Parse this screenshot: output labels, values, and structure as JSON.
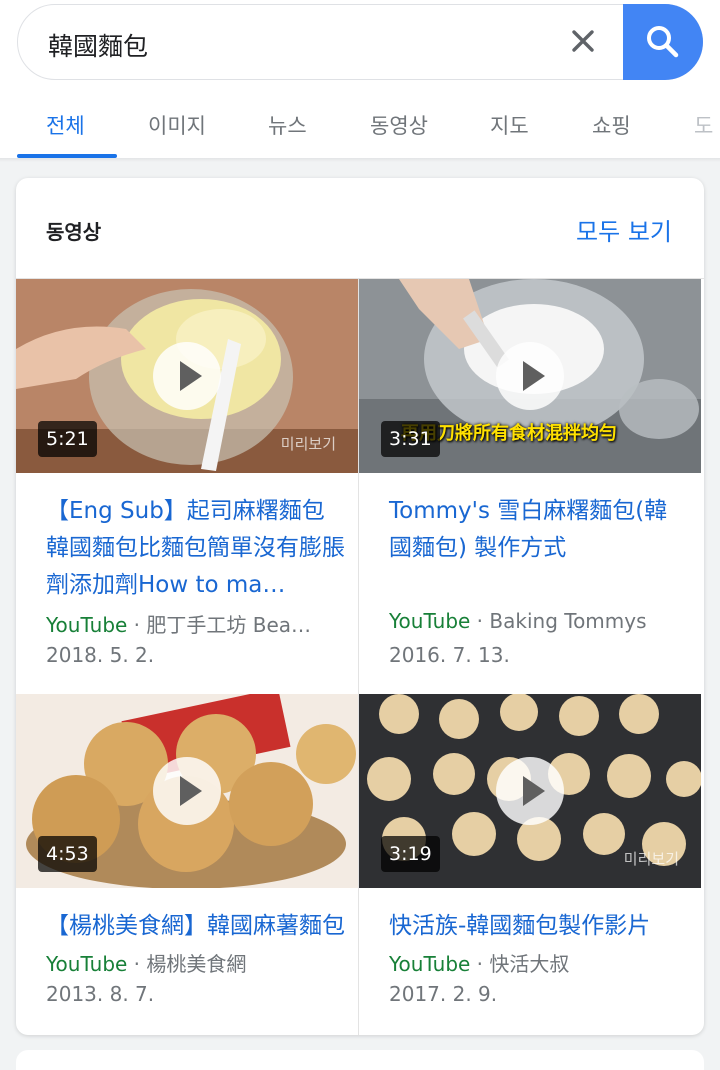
{
  "search": {
    "query": "韓國麵包"
  },
  "tabs": [
    "전체",
    "이미지",
    "뉴스",
    "동영상",
    "지도",
    "쇼핑",
    "도"
  ],
  "videos_card": {
    "title": "동영상",
    "see_all": "모두 보기",
    "preview_label": "미리보기",
    "items": [
      {
        "duration": "5:21",
        "title": "【Eng Sub】起司麻糬麵包韓國麵包比麵包簡單沒有膨脹劑添加劑How to ma…",
        "source": "YouTube",
        "channel": " · 肥丁手工坊 Bea…",
        "date": "2018. 5. 2."
      },
      {
        "duration": "3:31",
        "caption": "再用刀將所有食材混拌均勻",
        "title": "Tommy's 雪白麻糬麵包(韓國麵包) 製作方式",
        "source": "YouTube",
        "channel": " · Baking Tommys",
        "date": "2016. 7. 13."
      },
      {
        "duration": "4:53",
        "title": "【楊桃美食網】韓國麻薯麵包",
        "source": "YouTube",
        "channel": " · 楊桃美食網",
        "date": "2013. 8. 7."
      },
      {
        "duration": "3:19",
        "title": "快活族-韓國麵包製作影片",
        "source": "YouTube",
        "channel": " · 快活大叔",
        "date": "2017. 2. 9."
      }
    ]
  },
  "colors": {
    "accent": "#1a73e8",
    "search_button": "#4285f4",
    "source_green": "#188038"
  }
}
